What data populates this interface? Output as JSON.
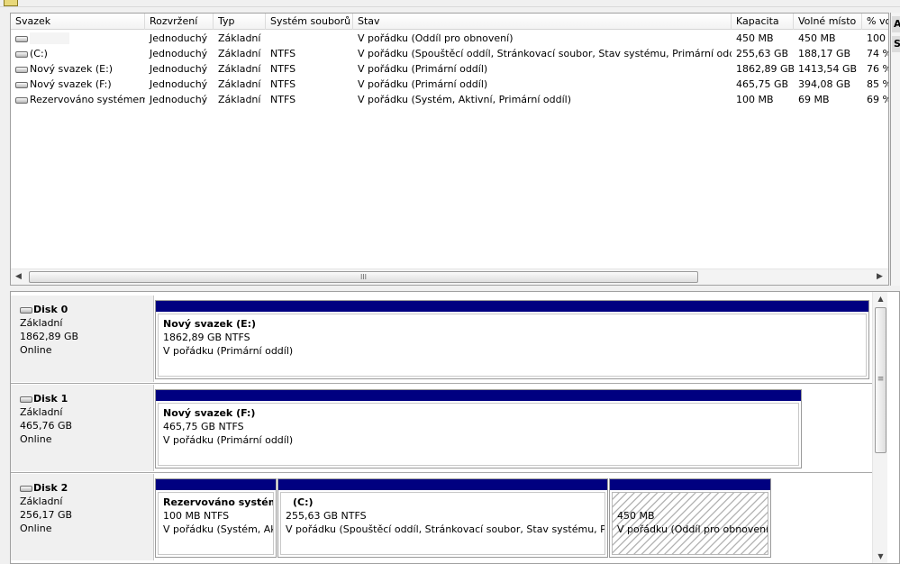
{
  "volume_list": {
    "columns": [
      "Svazek",
      "Rozvržení",
      "Typ",
      "Systém souborů",
      "Stav",
      "Kapacita",
      "Volné místo",
      "% vo"
    ],
    "rows": [
      {
        "volume": "",
        "layout": "Jednoduchý",
        "type": "Základní",
        "fs": "",
        "status": "V pořádku (Oddíl pro obnovení)",
        "capacity": "450 MB",
        "free": "450 MB",
        "pct": "100"
      },
      {
        "volume": "(C:)",
        "layout": "Jednoduchý",
        "type": "Základní",
        "fs": "NTFS",
        "status": "V pořádku (Spouštěcí oddíl, Stránkovací soubor, Stav systému, Primární oddíl)",
        "capacity": "255,63 GB",
        "free": "188,17 GB",
        "pct": "74 %"
      },
      {
        "volume": "Nový svazek (E:)",
        "layout": "Jednoduchý",
        "type": "Základní",
        "fs": "NTFS",
        "status": "V pořádku (Primární oddíl)",
        "capacity": "1862,89 GB",
        "free": "1413,54 GB",
        "pct": "76 %"
      },
      {
        "volume": "Nový svazek (F:)",
        "layout": "Jednoduchý",
        "type": "Základní",
        "fs": "NTFS",
        "status": "V pořádku (Primární oddíl)",
        "capacity": "465,75 GB",
        "free": "394,08 GB",
        "pct": "85 %"
      },
      {
        "volume": "Rezervováno systémem",
        "layout": "Jednoduchý",
        "type": "Základní",
        "fs": "NTFS",
        "status": "V pořádku (Systém, Aktivní, Primární oddíl)",
        "capacity": "100 MB",
        "free": "69 MB",
        "pct": "69 %"
      }
    ],
    "hscroll_grip": "III"
  },
  "right_panel": {
    "tab1": "A",
    "tab2": "S"
  },
  "disks": [
    {
      "name": "Disk 0",
      "type": "Základní",
      "size": "1862,89 GB",
      "state": "Online",
      "partitions": [
        {
          "name": "Nový svazek  (E:)",
          "size": "1862,89 GB NTFS",
          "status": "V pořádku (Primární oddíl)"
        }
      ]
    },
    {
      "name": "Disk 1",
      "type": "Základní",
      "size": "465,76 GB",
      "state": "Online",
      "partitions": [
        {
          "name": "Nový svazek  (F:)",
          "size": "465,75 GB NTFS",
          "status": "V pořádku (Primární oddíl)"
        }
      ]
    },
    {
      "name": "Disk 2",
      "type": "Základní",
      "size": "256,17 GB",
      "state": "Online",
      "partitions": [
        {
          "name": "Rezervováno systémem",
          "size": "100 MB NTFS",
          "status": "V pořádku (Systém, Aktivní, Primární oddíl)"
        },
        {
          "name": "(C:)",
          "size": "255,63 GB NTFS",
          "status": "V pořádku (Spouštěcí oddíl, Stránkovací soubor, Stav systému, Primární oddíl)"
        },
        {
          "name": "",
          "size": "450 MB",
          "status": "V pořádku (Oddíl pro obnovení)"
        }
      ]
    }
  ],
  "colors": {
    "partition_bar": "#000080",
    "panel_bg": "#f0f0f0"
  }
}
